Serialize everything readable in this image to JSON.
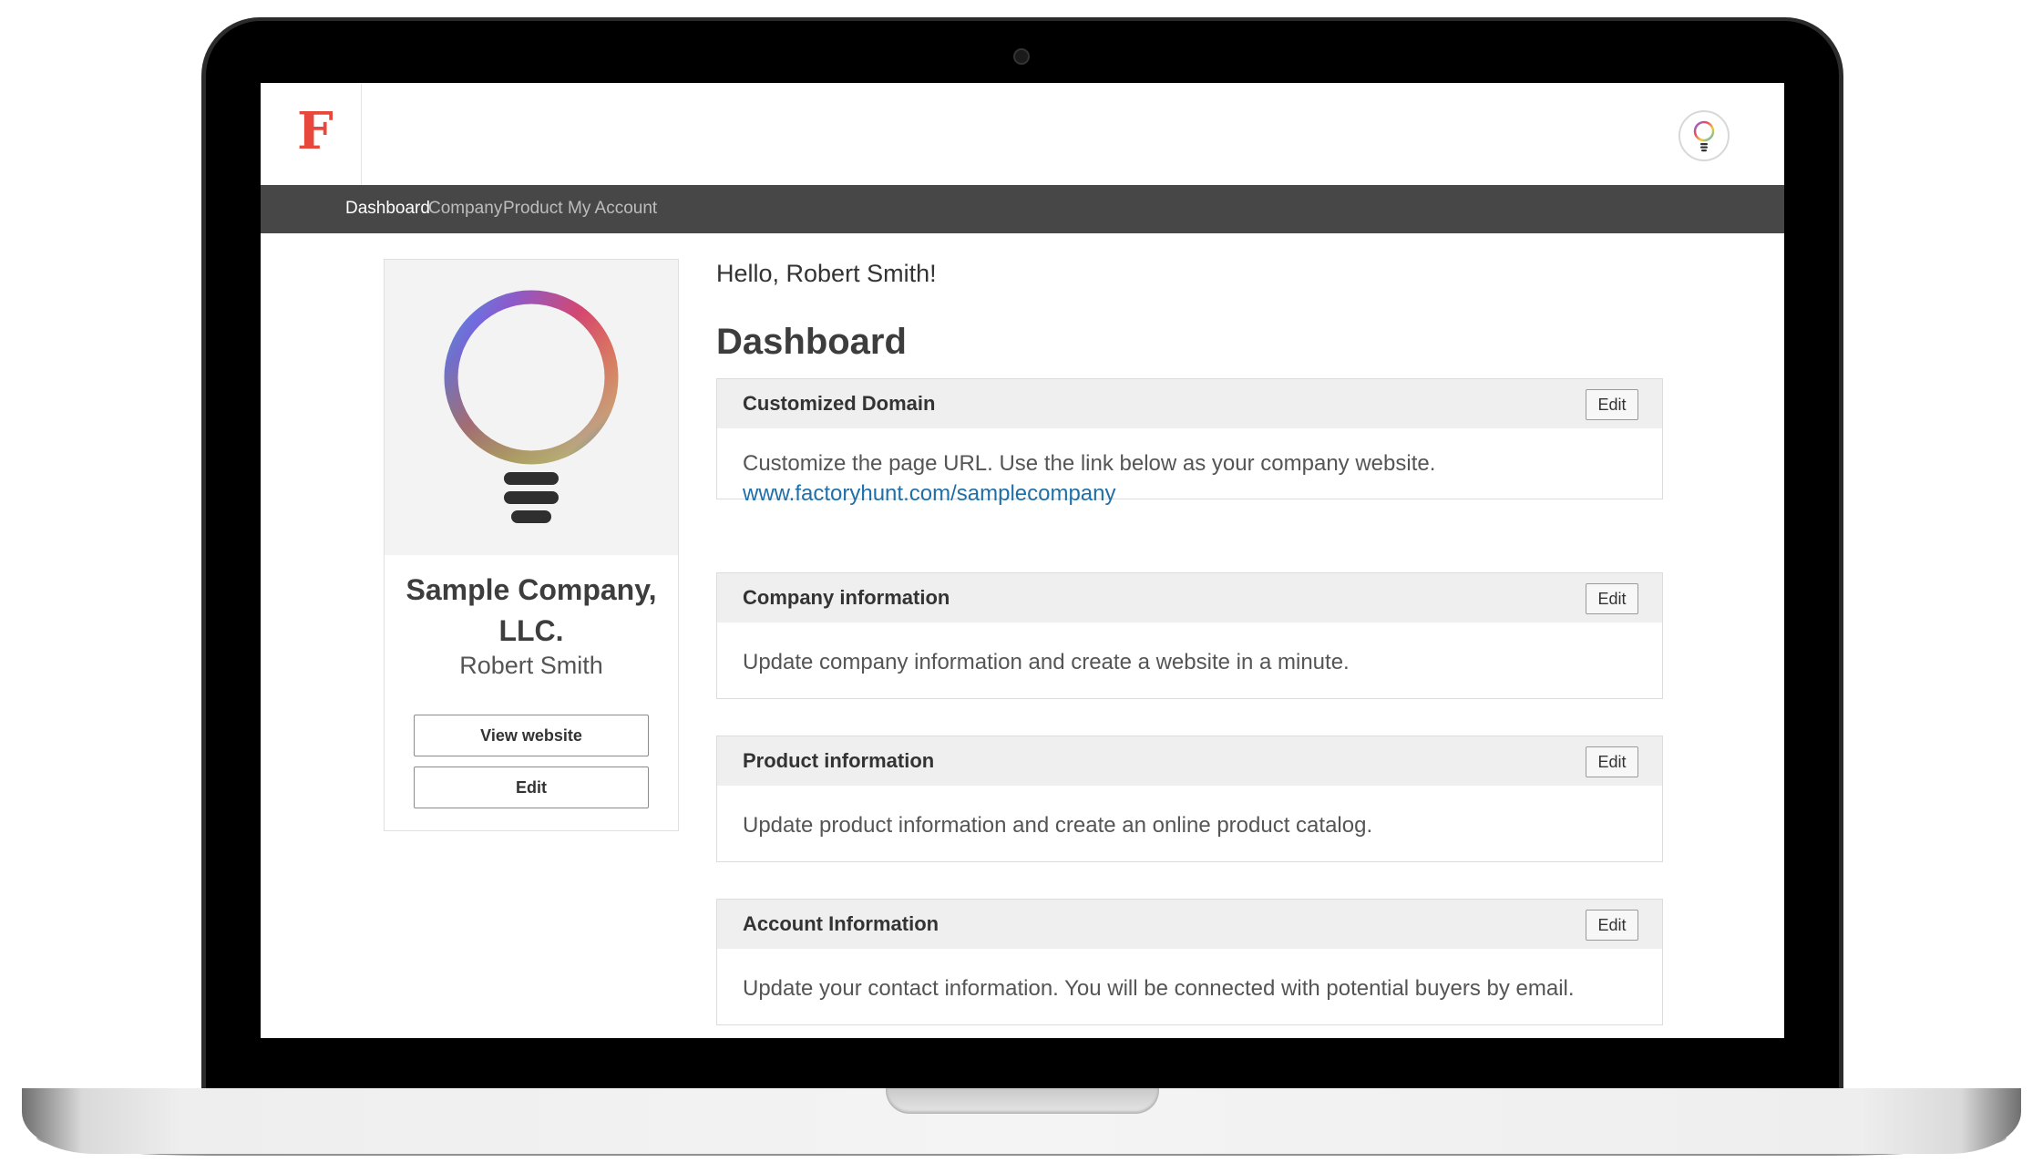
{
  "app": {
    "logo_letter": "F"
  },
  "nav": {
    "items": [
      "Dashboard",
      "Company",
      "Product",
      "My Account"
    ]
  },
  "profile": {
    "company_name_line1": "Sample Company,",
    "company_name_line2": "LLC.",
    "person_name": "Robert Smith",
    "view_website_label": "View website",
    "edit_label": "Edit"
  },
  "main": {
    "greeting": "Hello, Robert Smith!",
    "title": "Dashboard",
    "panels": [
      {
        "title": "Customized Domain",
        "edit_label": "Edit",
        "text": "Customize the page URL. Use the link below as your company website.",
        "link": "www.factoryhunt.com/samplecompany"
      },
      {
        "title": "Company information",
        "edit_label": "Edit",
        "text": "Update company information and create a website in a minute."
      },
      {
        "title": "Product information",
        "edit_label": "Edit",
        "text": "Update product information and create an online product catalog."
      },
      {
        "title": "Account Information",
        "edit_label": "Edit",
        "text": "Update your contact information. You will be connected with potential buyers by email."
      }
    ]
  },
  "colors": {
    "brand_red": "#e8483b",
    "nav_bg": "#474747",
    "link_blue": "#1f6fa8"
  }
}
